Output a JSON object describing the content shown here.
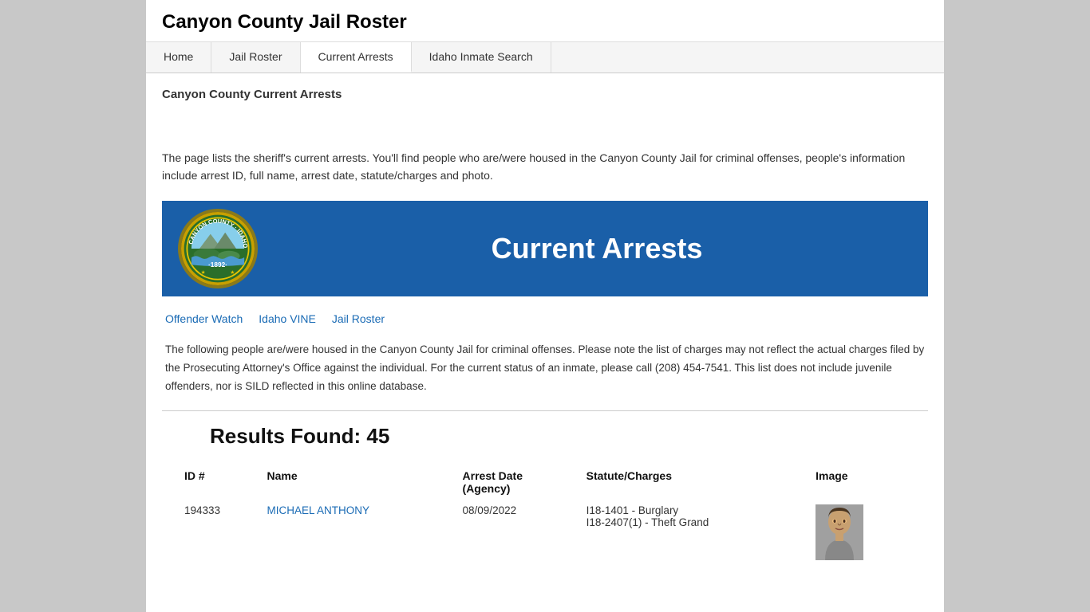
{
  "site": {
    "title": "Canyon County Jail Roster",
    "background_color": "#c8c8c8"
  },
  "nav": {
    "items": [
      {
        "label": "Home",
        "active": false
      },
      {
        "label": "Jail Roster",
        "active": false
      },
      {
        "label": "Current Arrests",
        "active": true
      },
      {
        "label": "Idaho Inmate Search",
        "active": false
      }
    ]
  },
  "page": {
    "section_title": "Canyon County Current Arrests",
    "description": "The page lists the sheriff's current arrests. You'll find people who are/were housed in the Canyon County Jail for criminal offenses, people's information include arrest ID, full name, arrest date, statute/charges and photo.",
    "banner_title": "Current Arrests",
    "sub_links": [
      {
        "label": "Offender Watch"
      },
      {
        "label": "Idaho VINE"
      },
      {
        "label": "Jail Roster"
      }
    ],
    "notice": "The following people are/were housed in the Canyon County Jail for criminal offenses. Please note the list of charges may not reflect the actual charges filed by the Prosecuting Attorney's Office against the individual. For the current status of an inmate, please call (208) 454-7541. This list does not include juvenile offenders, nor is SILD reflected in this online database.",
    "results_heading": "Results Found: 45",
    "table": {
      "headers": [
        "ID #",
        "Name",
        "Arrest Date\n(Agency)",
        "Statute/Charges",
        "Image"
      ],
      "rows": [
        {
          "id": "194333",
          "name": "MICHAEL ANTHONY",
          "arrest_date": "08/09/2022",
          "charges": [
            "I18-1401 - Burglary",
            "I18-2407(1) - Theft Grand"
          ],
          "has_photo": true
        }
      ]
    }
  }
}
